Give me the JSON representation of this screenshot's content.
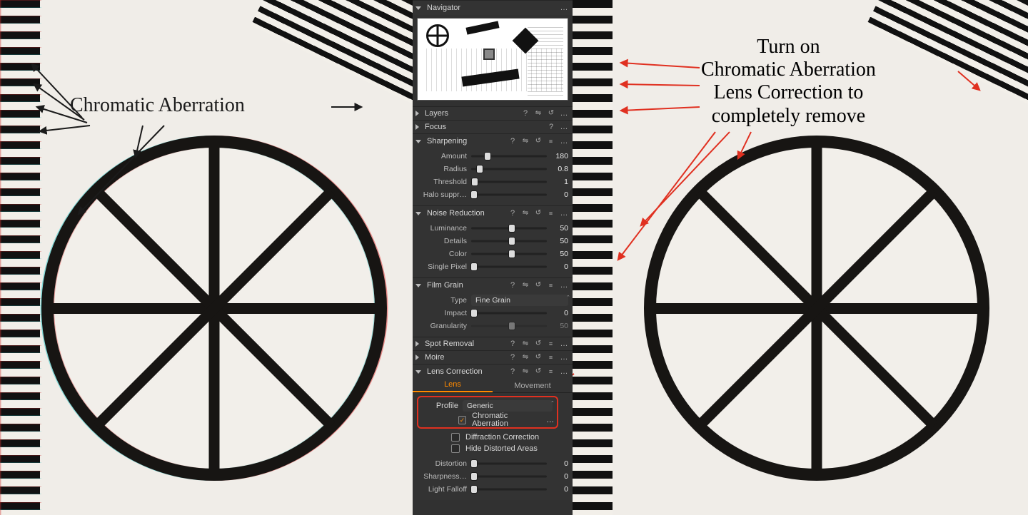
{
  "left": {
    "label": "Chromatic Aberration"
  },
  "right": {
    "line1": "Turn on",
    "line2": "Chromatic Aberration",
    "line3": "Lens Correction to",
    "line4": "completely remove"
  },
  "panel": {
    "navigator": {
      "title": "Navigator"
    },
    "layers": {
      "title": "Layers"
    },
    "focus": {
      "title": "Focus"
    },
    "sharpening": {
      "title": "Sharpening",
      "amount": {
        "label": "Amount",
        "value": "180"
      },
      "radius": {
        "label": "Radius",
        "value": "0.8"
      },
      "threshold": {
        "label": "Threshold",
        "value": "1"
      },
      "halo": {
        "label": "Halo suppr…",
        "value": "0"
      }
    },
    "noise": {
      "title": "Noise Reduction",
      "luminance": {
        "label": "Luminance",
        "value": "50"
      },
      "details": {
        "label": "Details",
        "value": "50"
      },
      "color": {
        "label": "Color",
        "value": "50"
      },
      "singlepx": {
        "label": "Single Pixel",
        "value": "0"
      }
    },
    "film": {
      "title": "Film Grain",
      "type": {
        "label": "Type",
        "value": "Fine Grain"
      },
      "impact": {
        "label": "Impact",
        "value": "0"
      },
      "granularity": {
        "label": "Granularity",
        "value": "50"
      }
    },
    "spot": {
      "title": "Spot Removal"
    },
    "moire": {
      "title": "Moire"
    },
    "lens": {
      "title": "Lens Correction",
      "tab_lens": "Lens",
      "tab_move": "Movement",
      "profile": {
        "label": "Profile",
        "value": "Generic"
      },
      "chk_ca": "Chromatic Aberration",
      "chk_dc": "Diffraction Correction",
      "chk_hda": "Hide Distorted Areas",
      "distortion": {
        "label": "Distortion",
        "value": "0"
      },
      "sharpness": {
        "label": "Sharpness…",
        "value": "0"
      },
      "light_falloff": {
        "label": "Light Falloff",
        "value": "0"
      }
    },
    "icons": {
      "help": "?",
      "reset": "↺",
      "copy": "⇋",
      "menu": "≡",
      "dots": "…"
    }
  }
}
